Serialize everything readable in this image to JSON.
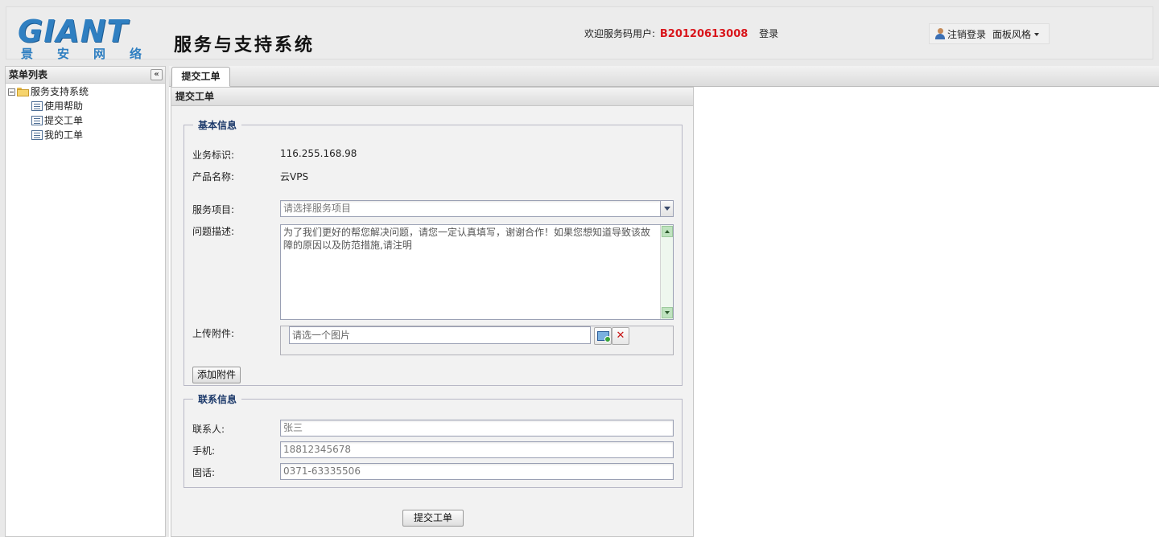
{
  "header": {
    "logo_text": "GIANT",
    "logo_sub": [
      "景",
      "安",
      "网",
      "络"
    ],
    "system_title": "服务与支持系统",
    "welcome_label": "欢迎服务码用户:",
    "service_code": "B20120613008",
    "login_link": "登录",
    "logout_label": "注销登录",
    "theme_label": "面板风格"
  },
  "sidebar": {
    "title": "菜单列表",
    "collapse_glyph": "«",
    "root": {
      "label": "服务支持系统"
    },
    "items": [
      {
        "label": "使用帮助"
      },
      {
        "label": "提交工单"
      },
      {
        "label": "我的工单"
      }
    ]
  },
  "tabs": [
    {
      "label": "提交工单",
      "active": true
    }
  ],
  "panel": {
    "title": "提交工单",
    "basic": {
      "legend": "基本信息",
      "business_id_label": "业务标识:",
      "business_id_value": "116.255.168.98",
      "product_label": "产品名称:",
      "product_value": "云VPS",
      "service_label": "服务项目:",
      "service_placeholder": "请选择服务项目",
      "desc_label": "问题描述:",
      "desc_text": "为了我们更好的帮您解决问题，请您一定认真填写，谢谢合作！如果您想知道导致该故障的原因以及防范措施,请注明",
      "upload_label": "上传附件:",
      "upload_placeholder": "请选一个图片",
      "add_attach_button": "添加附件"
    },
    "contact": {
      "legend": "联系信息",
      "name_label": "联系人:",
      "name_value": "张三",
      "mobile_label": "手机:",
      "mobile_value": "18812345678",
      "phone_label": "固话:",
      "phone_value": "0371-63335506"
    },
    "submit_button": "提交工单"
  },
  "colors": {
    "service_code": "#d9161c",
    "legend": "#1d3a6b",
    "logo": "#2f7fc1"
  }
}
